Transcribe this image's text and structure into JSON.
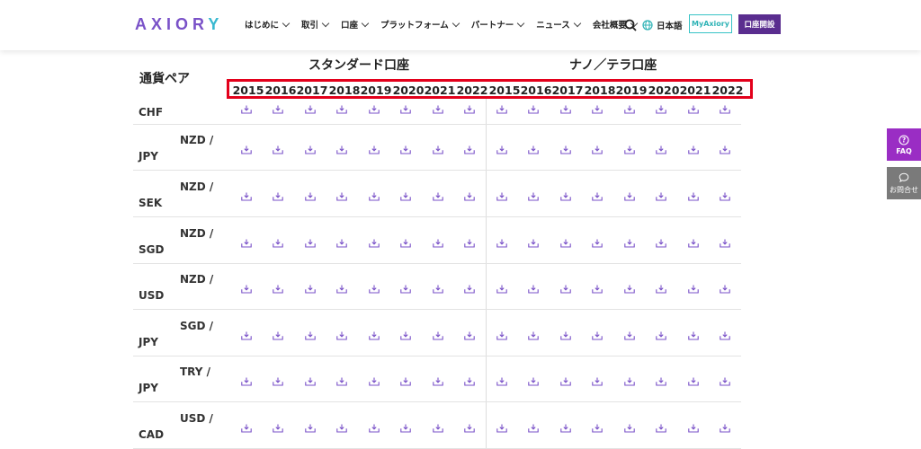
{
  "header": {
    "logo_main": "AXIOR",
    "logo_end": "Y",
    "nav": [
      "はじめに",
      "取引",
      "口座",
      "プラットフォーム",
      "パートナー",
      "ニュース",
      "会社概要"
    ],
    "language": "日本語",
    "myaxiory_label": "MyAxiory",
    "open_account_label": "口座開設"
  },
  "table": {
    "pair_header": "通貨ペア",
    "standard_header": "スタンダード口座",
    "nano_header": "ナノ／テラ口座",
    "years": [
      "2015",
      "2016",
      "2017",
      "2018",
      "2019",
      "2020",
      "2021",
      "2022"
    ],
    "rows": [
      {
        "top": "",
        "bottom": "CHF"
      },
      {
        "top": "NZD /",
        "bottom": "JPY"
      },
      {
        "top": "NZD /",
        "bottom": "SEK"
      },
      {
        "top": "NZD /",
        "bottom": "SGD"
      },
      {
        "top": "NZD /",
        "bottom": "USD"
      },
      {
        "top": "SGD /",
        "bottom": "JPY"
      },
      {
        "top": "TRY /",
        "bottom": "JPY"
      },
      {
        "top": "USD /",
        "bottom": "CAD"
      }
    ]
  },
  "side": {
    "faq_label": "FAQ",
    "contact_label": "お問合せ"
  },
  "colors": {
    "accent_purple": "#7a52c8",
    "brand_dark_purple": "#5a2d8f",
    "teal": "#37c3c6",
    "highlight_red": "#e3001b",
    "faq_purple": "#9a2dc4"
  }
}
